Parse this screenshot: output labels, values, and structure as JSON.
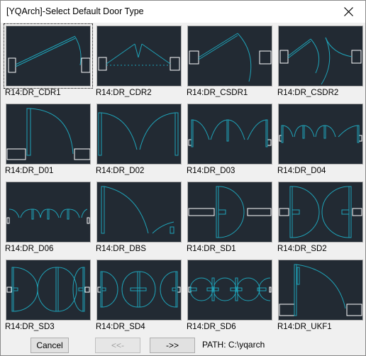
{
  "window": {
    "title": "[YQArch]-Select Default Door Type"
  },
  "door_types": [
    "R14:DR_CDR1",
    "R14:DR_CDR2",
    "R14:DR_CSDR1",
    "R14:DR_CSDR2",
    "R14:DR_D01",
    "R14:DR_D02",
    "R14:DR_D03",
    "R14:DR_D04",
    "R14:DR_D06",
    "R14:DR_DBS",
    "R14:DR_SD1",
    "R14:DR_SD2",
    "R14:DR_SD3",
    "R14:DR_SD4",
    "R14:DR_SD6",
    "R14:DR_UKF1"
  ],
  "selected_index": 0,
  "buttons": {
    "cancel": "Cancel",
    "prev": "<<-",
    "next": "->>"
  },
  "path_text": "PATH: C:\\yqarch",
  "colors": {
    "thumb_bg": "#222a33",
    "door_line": "#1fa3b8",
    "jamb": "#ffffff"
  }
}
